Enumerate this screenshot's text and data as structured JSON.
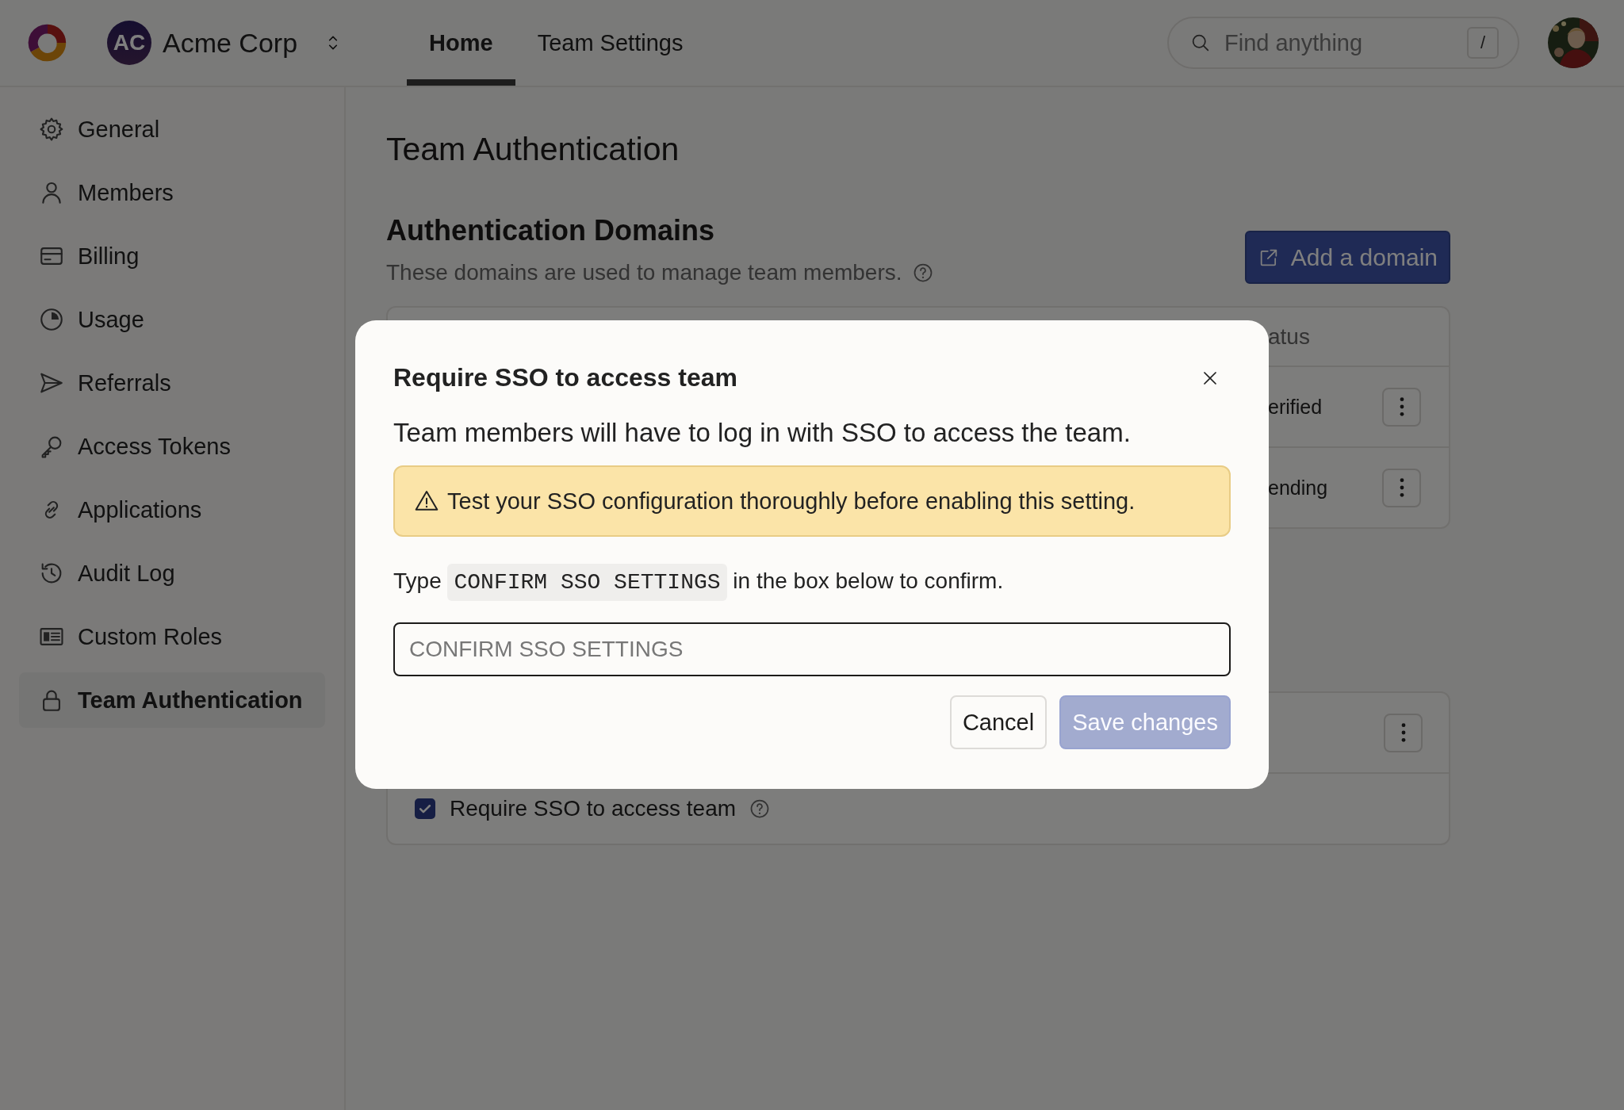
{
  "header": {
    "team_initials": "AC",
    "team_name": "Acme Corp",
    "tabs": [
      {
        "label": "Home",
        "selected": true
      },
      {
        "label": "Team Settings",
        "selected": false
      }
    ],
    "search": {
      "placeholder": "Find anything",
      "shortcut": "/"
    }
  },
  "sidebar": {
    "items": [
      {
        "label": "General",
        "selected": false
      },
      {
        "label": "Members",
        "selected": false
      },
      {
        "label": "Billing",
        "selected": false
      },
      {
        "label": "Usage",
        "selected": false
      },
      {
        "label": "Referrals",
        "selected": false
      },
      {
        "label": "Access Tokens",
        "selected": false
      },
      {
        "label": "Applications",
        "selected": false
      },
      {
        "label": "Audit Log",
        "selected": false
      },
      {
        "label": "Custom Roles",
        "selected": false
      },
      {
        "label": "Team Authentication",
        "selected": true
      }
    ]
  },
  "page": {
    "title": "Team Authentication",
    "domains": {
      "title": "Authentication Domains",
      "description": "These domains are used to manage team members.",
      "add_button": "Add a domain",
      "table": {
        "columns": [
          "atus"
        ],
        "rows": [
          {
            "status": "erified"
          },
          {
            "status": "ending"
          }
        ]
      }
    },
    "sso_card": {
      "rows": [
        {
          "kind": "menu"
        },
        {
          "kind": "checkbox",
          "label": "Require SSO to access team",
          "checked": true
        }
      ]
    }
  },
  "dialog": {
    "title": "Require SSO to access team",
    "description": "Team members will have to log in with SSO to access the team.",
    "warning": "Test your SSO configuration thoroughly before enabling this setting.",
    "instruction": {
      "before": "Type",
      "code": "CONFIRM SSO SETTINGS",
      "after": "in the box below to confirm."
    },
    "input": {
      "placeholder": "CONFIRM SSO SETTINGS"
    },
    "buttons": [
      {
        "label": "Cancel",
        "kind": "secondary",
        "disabled": false
      },
      {
        "label": "Save changes",
        "kind": "primary",
        "disabled": true
      }
    ]
  }
}
